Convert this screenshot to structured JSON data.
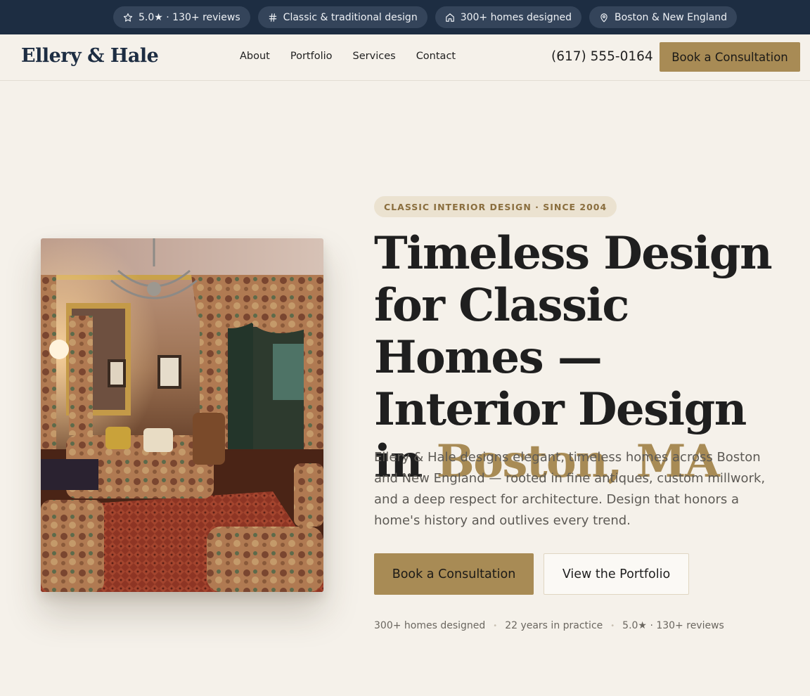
{
  "topbar": {
    "pills": [
      {
        "icon": "star-icon",
        "label": "5.0★ · 130+ reviews"
      },
      {
        "icon": "hash-icon",
        "label": "Classic & traditional design"
      },
      {
        "icon": "home-icon",
        "label": "300+ homes designed"
      },
      {
        "icon": "map-pin-icon",
        "label": "Boston & New England"
      }
    ]
  },
  "nav": {
    "logo": "Ellery & Hale",
    "links": [
      "About",
      "Portfolio",
      "Services",
      "Contact"
    ],
    "phone": "(617) 555-0164",
    "cta": "Book a Consultation"
  },
  "hero": {
    "eyebrow": "CLASSIC INTERIOR DESIGN · SINCE 2004",
    "headline_main": "Timeless Design for Classic Homes — Interior Design in ",
    "headline_accent": "Boston, MA",
    "lede": "Ellery & Hale designs elegant, timeless homes across Boston and New England — rooted in fine antiques, custom millwork, and a deep respect for architecture. Design that honors a home's history and outlives every trend.",
    "primary_cta": "Book a Consultation",
    "secondary_cta": "View the Portfolio",
    "stats": [
      "300+ homes designed",
      "22 years in practice",
      "5.0★ · 130+ reviews"
    ]
  },
  "colors": {
    "navy": "#1d2d42",
    "gold": "#a88b55",
    "cream": "#f5f1ea"
  }
}
